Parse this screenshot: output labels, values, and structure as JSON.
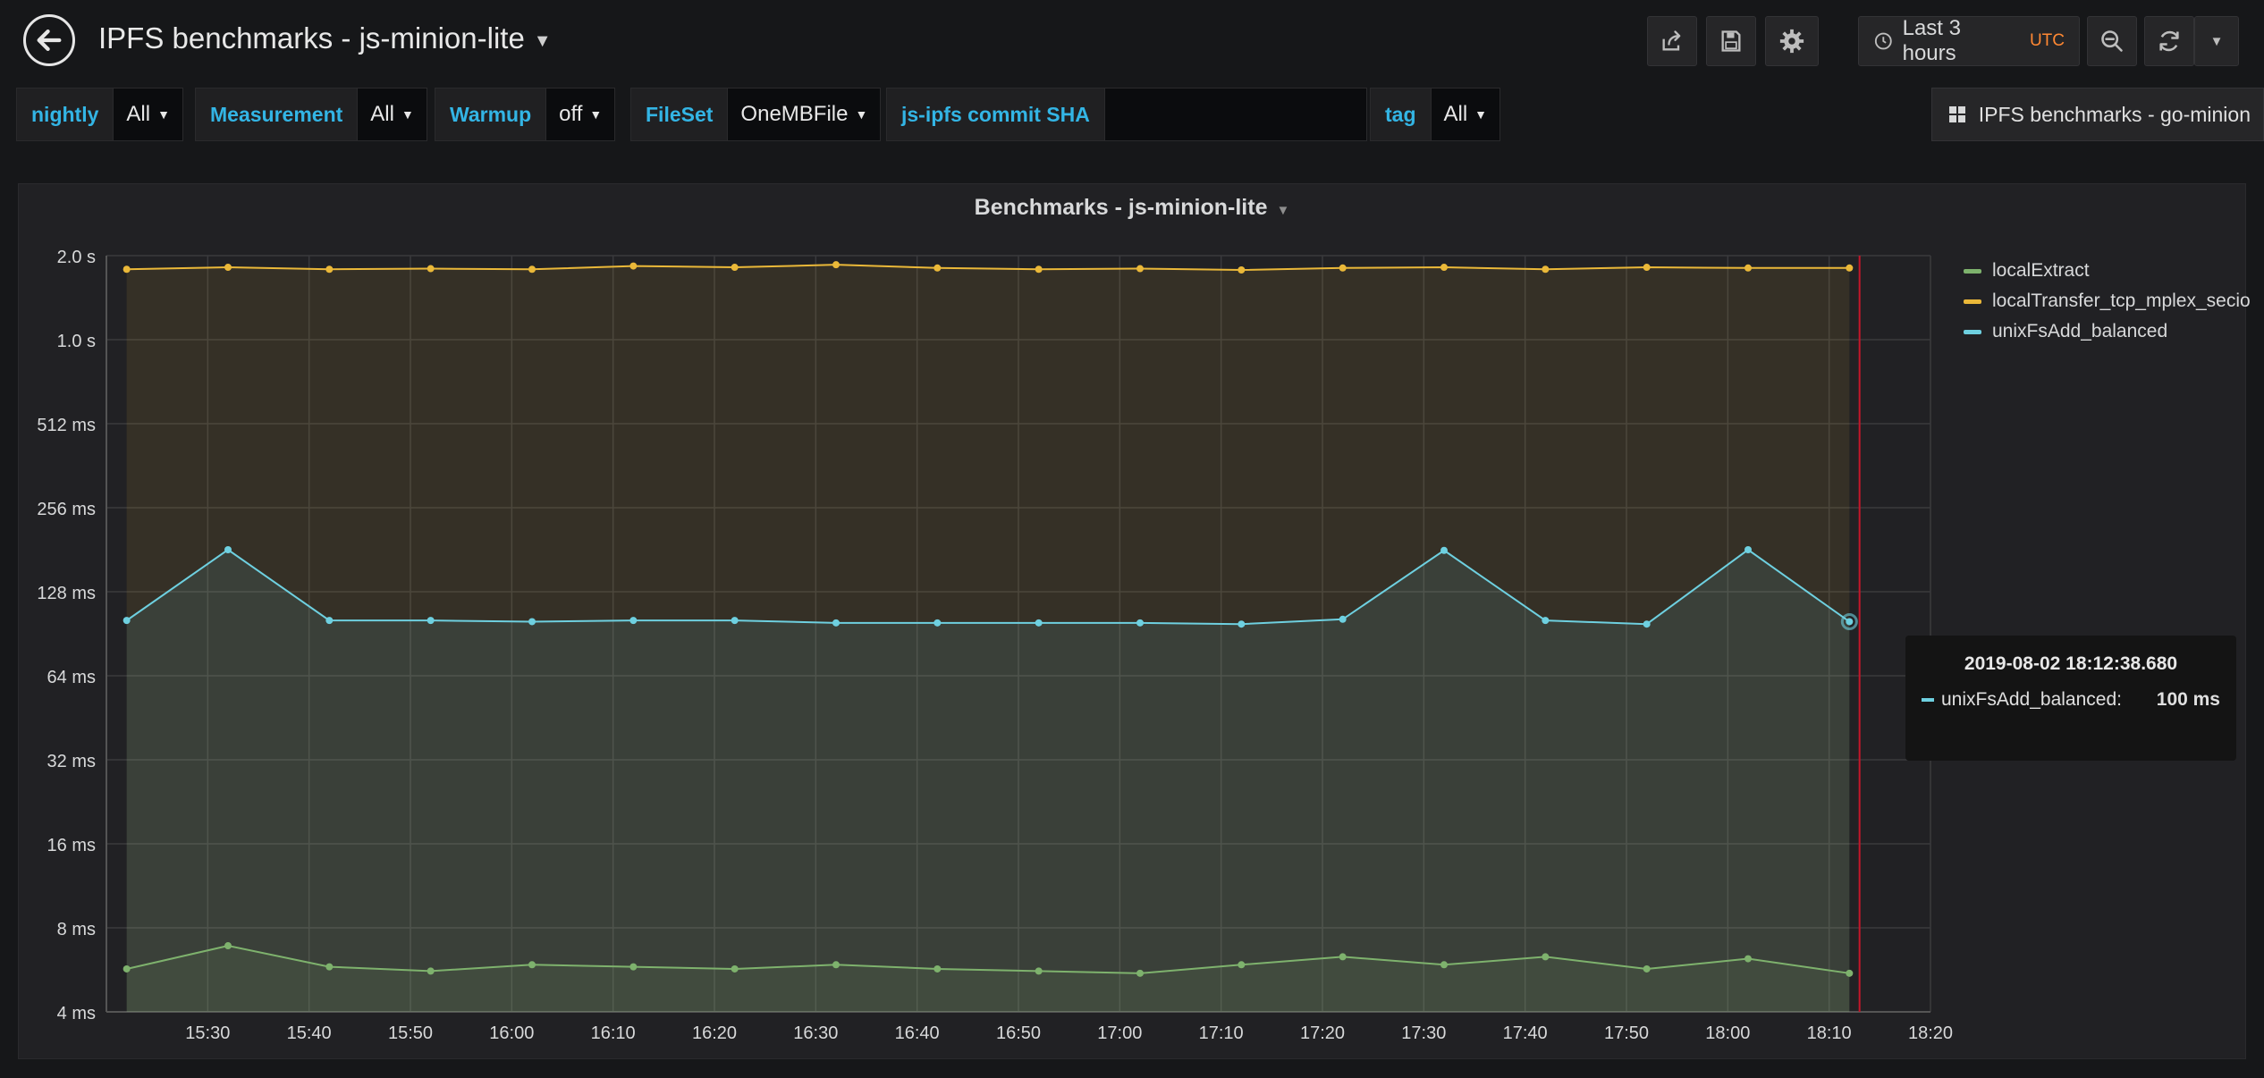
{
  "navbar": {
    "title": "IPFS benchmarks - js-minion-lite",
    "time_range": "Last 3 hours",
    "timezone": "UTC"
  },
  "variables": [
    {
      "label": "nightly",
      "value": "All"
    },
    {
      "label": "Measurement",
      "value": "All"
    },
    {
      "label": "Warmup",
      "value": "off"
    },
    {
      "label": "FileSet",
      "value": "OneMBFile"
    },
    {
      "label": "js-ipfs commit SHA",
      "value": ""
    },
    {
      "label": "tag",
      "value": "All"
    }
  ],
  "dashboard_link": "IPFS benchmarks - go-minion",
  "panel": {
    "title": "Benchmarks - js-minion-lite"
  },
  "tooltip": {
    "time": "2019-08-02 18:12:38.680",
    "series": "unixFsAdd_balanced:",
    "value": "100 ms"
  },
  "colors": {
    "localExtract": "#7eb26d",
    "localTransfer_tcp_mplex_secio": "#eab839",
    "unixFsAdd_balanced": "#6ed0e0",
    "var_label": "#33b5e5",
    "utc": "#ff8833"
  },
  "chart_data": {
    "type": "line",
    "title": "Benchmarks - js-minion-lite",
    "y_scale": "log2",
    "y_unit": "ms",
    "ylim": [
      4,
      2048
    ],
    "y_ticks": [
      {
        "value": 2048,
        "label": "2.0 s"
      },
      {
        "value": 1024,
        "label": "1.0 s"
      },
      {
        "value": 512,
        "label": "512 ms"
      },
      {
        "value": 256,
        "label": "256 ms"
      },
      {
        "value": 128,
        "label": "128 ms"
      },
      {
        "value": 64,
        "label": "64 ms"
      },
      {
        "value": 32,
        "label": "32 ms"
      },
      {
        "value": 16,
        "label": "16 ms"
      },
      {
        "value": 8,
        "label": "8 ms"
      },
      {
        "value": 4,
        "label": "4 ms"
      }
    ],
    "x_ticks": [
      "15:30",
      "15:40",
      "15:50",
      "16:00",
      "16:10",
      "16:20",
      "16:30",
      "16:40",
      "16:50",
      "17:00",
      "17:10",
      "17:20",
      "17:30",
      "17:40",
      "17:50",
      "18:00",
      "18:10",
      "18:20"
    ],
    "xlim": [
      "15:20",
      "18:20"
    ],
    "x": [
      "15:22",
      "15:32",
      "15:42",
      "15:52",
      "16:02",
      "16:12",
      "16:22",
      "16:32",
      "16:42",
      "16:52",
      "17:02",
      "17:12",
      "17:22",
      "17:32",
      "17:42",
      "17:52",
      "18:02",
      "18:12"
    ],
    "cursor_time": "18:13",
    "legend_position": "right",
    "series": [
      {
        "name": "localExtract",
        "values": [
          5.7,
          6.9,
          5.8,
          5.6,
          5.9,
          5.8,
          5.7,
          5.9,
          5.7,
          5.6,
          5.5,
          5.9,
          6.3,
          5.9,
          6.3,
          5.7,
          6.2,
          5.5
        ]
      },
      {
        "name": "localTransfer_tcp_mplex_secio",
        "values": [
          1830,
          1860,
          1830,
          1840,
          1830,
          1880,
          1860,
          1900,
          1850,
          1830,
          1840,
          1820,
          1850,
          1860,
          1830,
          1860,
          1850,
          1850
        ]
      },
      {
        "name": "unixFsAdd_balanced",
        "values": [
          101,
          181,
          101,
          101,
          100,
          101,
          101,
          99,
          99,
          99,
          99,
          98,
          102,
          180,
          101,
          98,
          181,
          100
        ]
      }
    ]
  }
}
